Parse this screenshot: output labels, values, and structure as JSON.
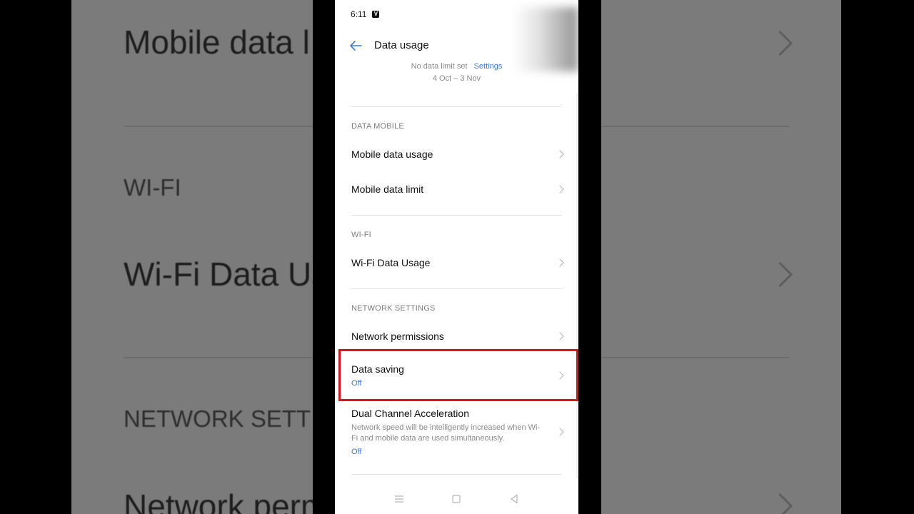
{
  "background": {
    "items": [
      {
        "kind": "big",
        "text": "Mobile data l"
      },
      {
        "kind": "header",
        "text": "WI-FI"
      },
      {
        "kind": "big",
        "text": "Wi-Fi Data Us"
      },
      {
        "kind": "header",
        "text": "NETWORK SETT"
      },
      {
        "kind": "big",
        "text": "Network perm"
      }
    ]
  },
  "status_bar": {
    "time": "6:11",
    "app_icon_glyph": "V"
  },
  "header": {
    "title": "Data usage",
    "back_icon": "arrow-left-icon"
  },
  "summary": {
    "limit_text": "No data limit set",
    "settings_link": "Settings",
    "date_range": "4 Oct – 3 Nov"
  },
  "sections": {
    "data_mobile": {
      "header": "DATA MOBILE",
      "items": [
        {
          "label": "Mobile data usage"
        },
        {
          "label": "Mobile data limit"
        }
      ]
    },
    "wifi": {
      "header": "WI-FI",
      "items": [
        {
          "label": "Wi-Fi Data Usage"
        }
      ]
    },
    "network_settings": {
      "header": "NETWORK SETTINGS",
      "items": [
        {
          "label": "Network permissions"
        },
        {
          "label": "Data saving",
          "status": "Off"
        },
        {
          "label": "Dual Channel Acceleration",
          "description": "Network speed will be intelligently increased when Wi-Fi and mobile data are used simultaneously.",
          "status": "Off"
        }
      ]
    }
  },
  "colors": {
    "accent": "#3b7ddd",
    "highlight_border": "#d7151f",
    "text_primary": "#111111",
    "text_secondary": "#8a8a8a"
  },
  "navbar": {
    "icons": [
      "menu-icon",
      "home-square-icon",
      "back-triangle-icon"
    ]
  }
}
